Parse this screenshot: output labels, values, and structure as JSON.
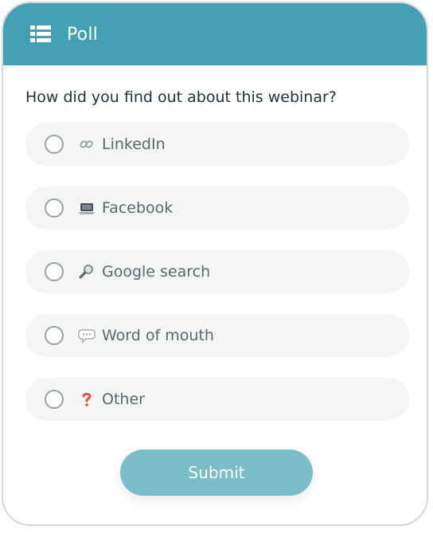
{
  "header": {
    "title": "Poll",
    "icon": "list-icon",
    "background": "#43a1b3"
  },
  "question": "How did you find out about this webinar?",
  "options": [
    {
      "icon": "link-icon",
      "label": "LinkedIn"
    },
    {
      "icon": "laptop-icon",
      "label": "Facebook"
    },
    {
      "icon": "magnifier-icon",
      "label": "Google search"
    },
    {
      "icon": "speech-bubble-icon",
      "label": "Word of mouth"
    },
    {
      "icon": "question-mark-icon",
      "label": "Other"
    }
  ],
  "submit": {
    "label": "Submit",
    "background": "#79bdc8"
  }
}
